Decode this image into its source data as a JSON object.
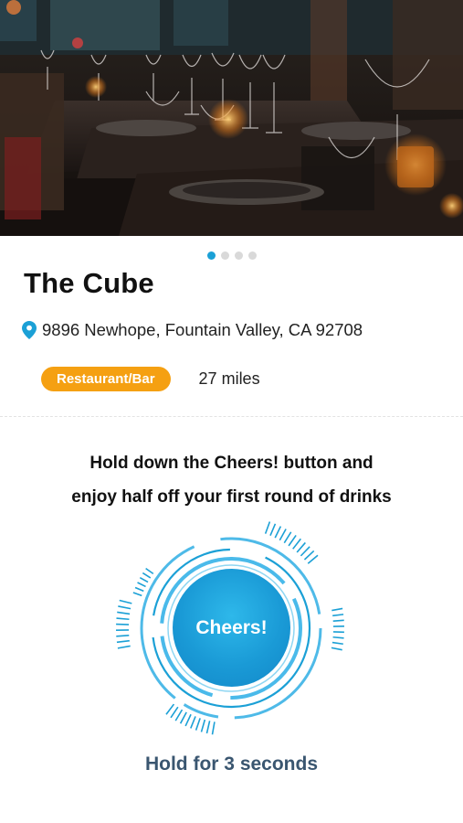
{
  "hero": {
    "carousel": {
      "page_count": 4,
      "active_index": 0
    }
  },
  "venue": {
    "name": "The Cube",
    "address": "9896 Newhope, Fountain Valley, CA 92708",
    "category": "Restaurant/Bar",
    "distance": "27 miles"
  },
  "promo": {
    "line1": "Hold down the Cheers! button and",
    "line2": "enjoy half off your first round of drinks",
    "button_label": "Cheers!",
    "hold_hint": "Hold for 3 seconds"
  },
  "icons": {
    "address": "map-pin-icon"
  },
  "colors": {
    "accent": "#1ba0d6",
    "badge": "#f5a012",
    "hint_text": "#3a5670"
  }
}
